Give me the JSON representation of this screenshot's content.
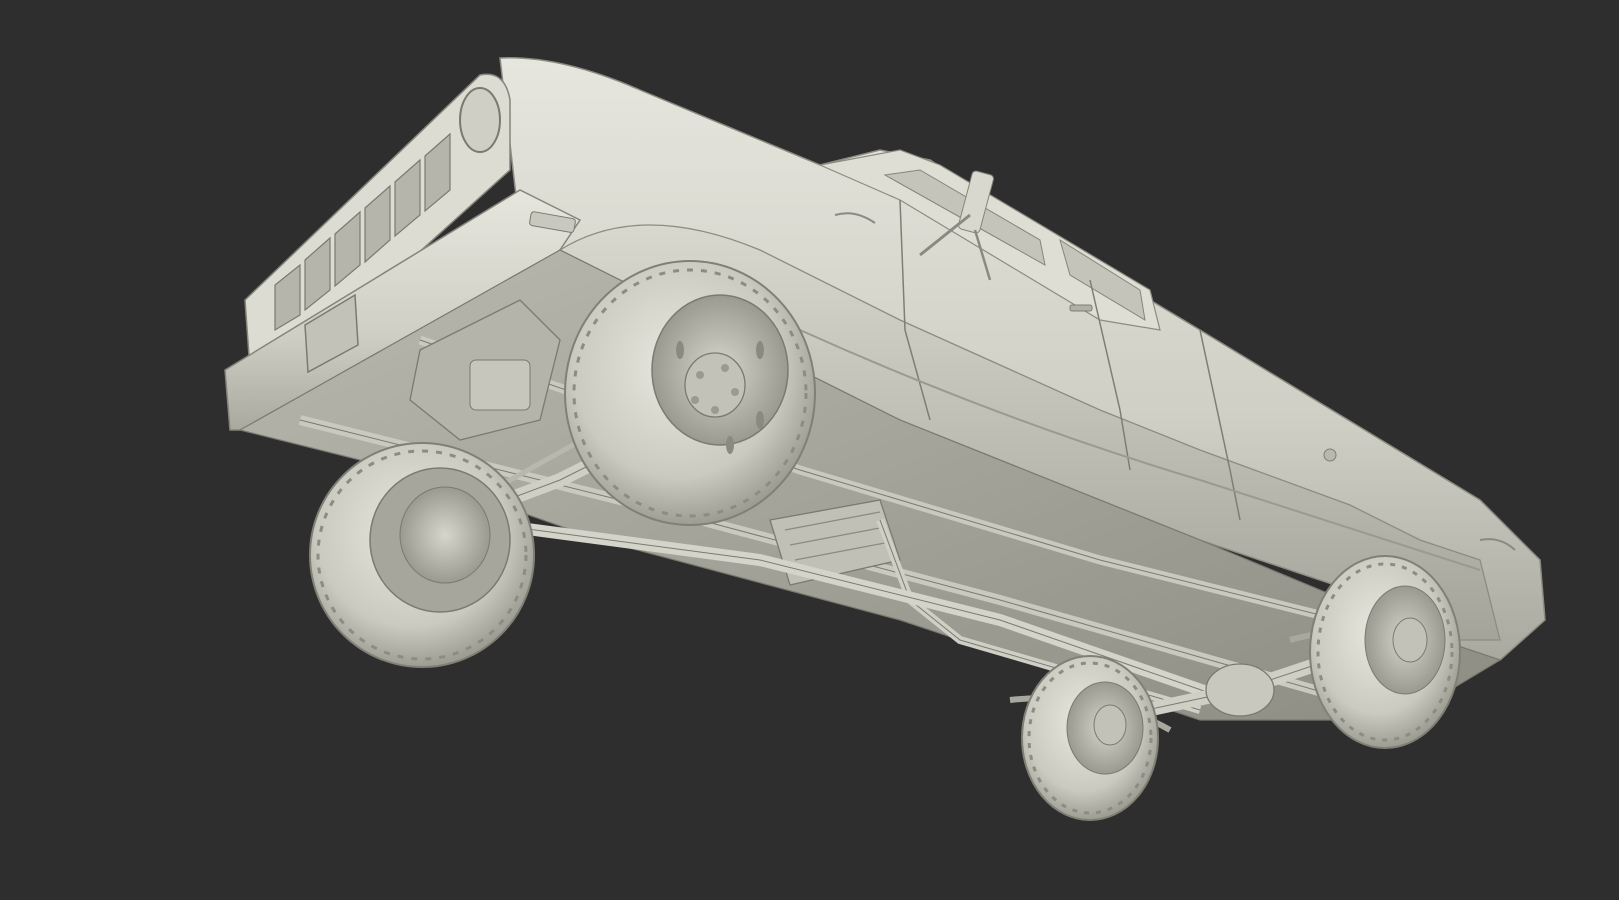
{
  "viewport": {
    "background_color": "#2e2e2e",
    "model_color": "#d2d2c8",
    "model_shadow_color": "#8e8e84",
    "model_highlight_color": "#ecece4"
  },
  "model": {
    "subject": "pickup-truck-model",
    "view": "low-angle-underside"
  }
}
